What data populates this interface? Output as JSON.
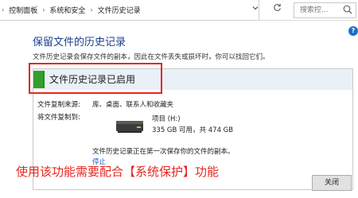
{
  "address_bar": {
    "crumbs": [
      "控制面板",
      "系统和安全",
      "文件历史记录"
    ],
    "separator": "›",
    "dropdown_icon": "chevron-down-icon",
    "refresh_icon": "refresh-icon",
    "search_placeholder": "搜索控...",
    "search_icon": "search-icon"
  },
  "help_icon": "?",
  "page": {
    "title": "保留文件的历史记录",
    "description": "文件历史记录会保存文件的副本，因此在文件丢失或损坏时，你可以找回它们。"
  },
  "panel": {
    "status": "文件历史记录已启用",
    "source_label": "文件复制来源:",
    "source_value": "库、桌面、联系人和收藏夹",
    "dest_label": "将文件复制到:",
    "drive_name": "项目 (H:)",
    "drive_space": "335 GB 可用，共 474 GB",
    "info": "文件历史记录正在第一次保存你的文件的副本。",
    "stop_link": "停止"
  },
  "annotation": "使用该功能需要配合【系统保护】功能",
  "close_button": "关闭",
  "colors": {
    "title": "#1a3f8a",
    "status_bar": "#e9f0f8",
    "status_green": "#33a02c",
    "annotation_red": "#e8261f",
    "link": "#1a56c4"
  }
}
